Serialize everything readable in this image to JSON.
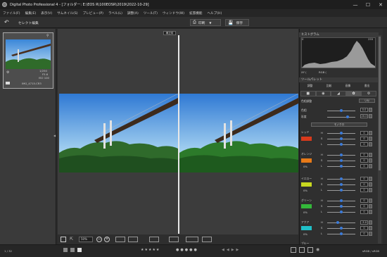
{
  "window": {
    "title": "Digital Photo Professional 4 - [フォルダー: E:\\EOS R\\100EOSR\\2019\\2022-10-29]",
    "minimize": "—",
    "maximize": "☐",
    "close": "✕"
  },
  "menu": [
    "ファイル(F)",
    "編集(E)",
    "表示(V)",
    "サムネイル(S)",
    "プレビュー(P)",
    "ラベル(L)",
    "調整(A)",
    "ツール(T)",
    "ウィンドウ(W)",
    "拡張機能",
    "ヘルプ(H)"
  ],
  "toolbar": {
    "back_label": "セレクト編集",
    "print_label": "印刷",
    "save_label": "保存"
  },
  "thumbnail": {
    "label": "IMG_4715.CR3",
    "info_lines": [
      "1/250",
      "F5.6",
      "ISO 100"
    ]
  },
  "viewer": {
    "top_tab": "補正前",
    "zoom_value": "50%"
  },
  "status": {
    "count": "1 / 32",
    "page": "sRGB / sRGB"
  },
  "right_panel": {
    "histogram_title": "ヒストグラム",
    "hist_min": "0",
    "hist_max": "255",
    "xy_label": "XY (",
    "rgb_label": "RGB (",
    "tool_palette_title": "ツールパレット",
    "tool_buttons": [
      "調整",
      "比較",
      "画像",
      "書出"
    ],
    "color_section": "色相調整",
    "reset_label": "リセ",
    "hue_label": "色相",
    "sat_label": "彩度",
    "hue_value": "0.0",
    "sat_value": "20.0",
    "mode_label": "モノクロ",
    "colors": [
      {
        "name": "レッド",
        "color": "#d83a1c",
        "h": "0",
        "s": "0",
        "l": "0"
      },
      {
        "name": "オレンジ",
        "color": "#e87a18",
        "h": "0",
        "s": "0",
        "l": "0"
      },
      {
        "name": "イエロー",
        "color": "#c8d820",
        "h": "0",
        "s": "0",
        "l": "0"
      },
      {
        "name": "グリーン",
        "color": "#34b83a",
        "h": "0",
        "s": "0",
        "l": "0"
      },
      {
        "name": "アクア",
        "color": "#20c0c8",
        "h": "-3.0",
        "s": "0",
        "l": "0"
      },
      {
        "name": "ブルー",
        "color": "#2c5ad8",
        "h": "0",
        "s": "0",
        "l": "0"
      }
    ],
    "h_letter": "H",
    "s_letter": "S",
    "l_letter": "L",
    "pct_label": "0%"
  }
}
